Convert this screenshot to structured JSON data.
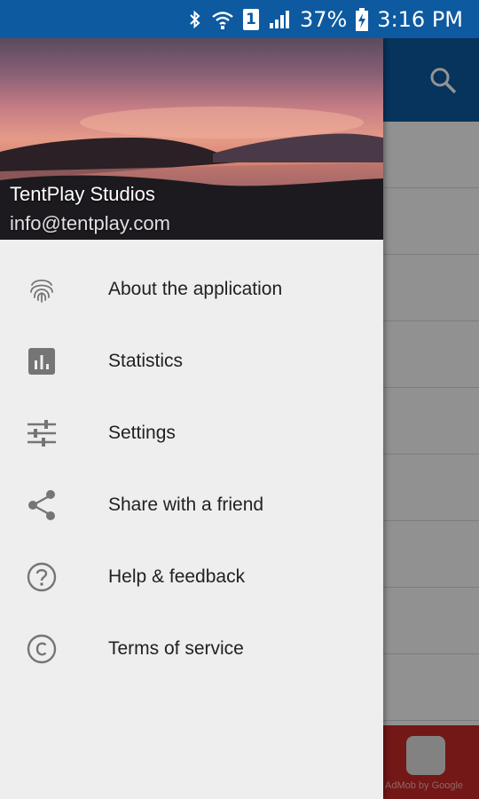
{
  "status_bar": {
    "battery": "37%",
    "time": "3:16 PM",
    "sim": "1",
    "icons": [
      "bluetooth-icon",
      "wifi-icon",
      "sim-icon",
      "signal-icon",
      "battery-charging-icon"
    ]
  },
  "drawer": {
    "header": {
      "name": "TentPlay Studios",
      "email": "info@tentplay.com"
    },
    "items": [
      {
        "label": "About the application",
        "icon": "fingerprint-icon"
      },
      {
        "label": "Statistics",
        "icon": "bar-chart-icon"
      },
      {
        "label": "Settings",
        "icon": "tune-sliders-icon"
      },
      {
        "label": "Share with a friend",
        "icon": "share-icon"
      },
      {
        "label": "Help & feedback",
        "icon": "help-circle-icon"
      },
      {
        "label": "Terms of service",
        "icon": "copyright-icon"
      }
    ]
  },
  "background": {
    "toolbar_icon": "search-icon",
    "ad_text": "AdMob by Google"
  },
  "colors": {
    "primary": "#0d5aa0",
    "drawer_bg": "#eeeeee",
    "icon_gray": "#757575",
    "ad_red": "#c62828"
  }
}
